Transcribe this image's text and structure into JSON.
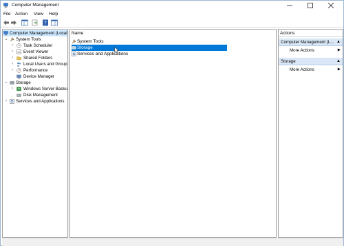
{
  "window": {
    "title": "Computer Management",
    "icon": "computer-management-icon"
  },
  "menu": {
    "file": "File",
    "action": "Action",
    "view": "View",
    "help": "Help"
  },
  "tree": {
    "root": "Computer Management (Local",
    "system_tools": "System Tools",
    "task_scheduler": "Task Scheduler",
    "event_viewer": "Event Viewer",
    "shared_folders": "Shared Folders",
    "local_users": "Local Users and Groups",
    "performance": "Performance",
    "device_manager": "Device Manager",
    "storage": "Storage",
    "windows_server_backup": "Windows Server Backup",
    "disk_management": "Disk Management",
    "services": "Services and Applications"
  },
  "center": {
    "column_name": "Name",
    "items": [
      "System Tools",
      "Storage",
      "Services and Applications"
    ]
  },
  "actions": {
    "header": "Actions",
    "section1": "Computer Management (L...",
    "more1": "More Actions",
    "section2": "Storage",
    "more2": "More Actions"
  },
  "colors": {
    "selection": "#0078d7",
    "tree_selected": "#cce8ff",
    "action_section": "#d9e7f6"
  }
}
